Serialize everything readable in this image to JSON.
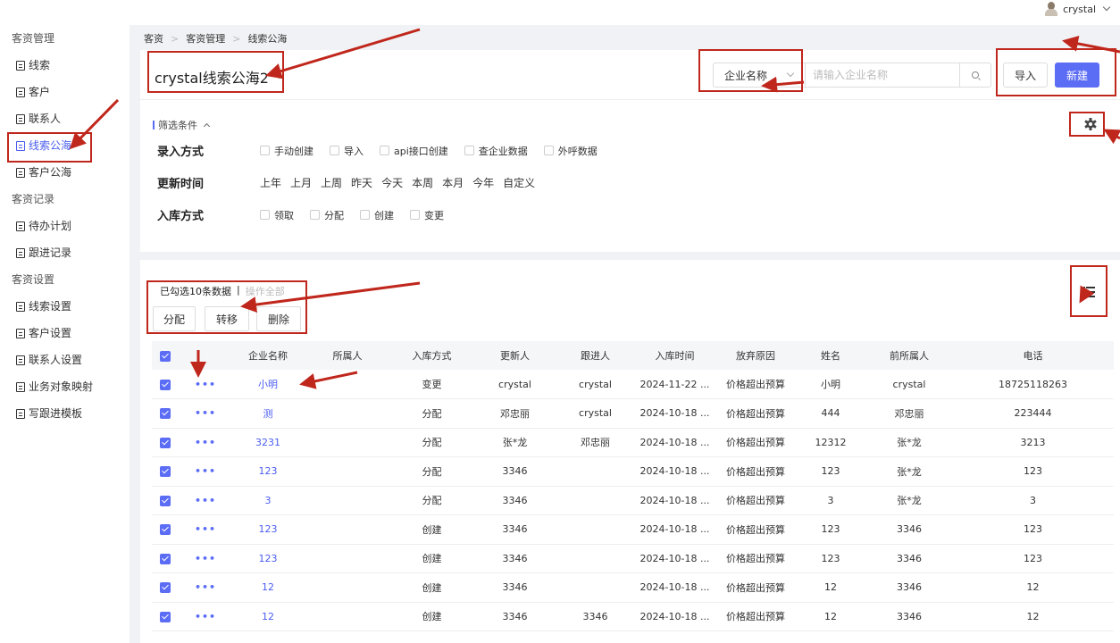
{
  "header": {
    "username": "crystal"
  },
  "sidebar": {
    "groups": [
      {
        "title": "客资管理",
        "items": [
          "线索",
          "客户",
          "联系人",
          "线索公海",
          "客户公海"
        ]
      },
      {
        "title": "客资记录",
        "items": [
          "待办计划",
          "跟进记录"
        ]
      },
      {
        "title": "客资设置",
        "items": [
          "线索设置",
          "客户设置",
          "联系人设置",
          "业务对象映射",
          "写跟进模板"
        ]
      }
    ],
    "active_item": "线索公海"
  },
  "breadcrumb": [
    "客资",
    "客资管理",
    "线索公海"
  ],
  "page": {
    "title": "crystal线索公海2"
  },
  "search": {
    "field_select": "企业名称",
    "placeholder": "请输入企业名称",
    "import_label": "导入",
    "new_label": "新建"
  },
  "filter": {
    "toggle_label": "筛选条件",
    "rows": [
      {
        "label": "录入方式",
        "type": "checkbox",
        "options": [
          "手动创建",
          "导入",
          "api接口创建",
          "查企业数据",
          "外呼数据"
        ]
      },
      {
        "label": "更新时间",
        "type": "text",
        "options": [
          "上年",
          "上月",
          "上周",
          "昨天",
          "今天",
          "本周",
          "本月",
          "今年",
          "自定义"
        ]
      },
      {
        "label": "入库方式",
        "type": "checkbox",
        "options": [
          "领取",
          "分配",
          "创建",
          "变更"
        ]
      }
    ]
  },
  "selection": {
    "info": "已勾选10条数据",
    "separator": "|",
    "all_label": "操作全部"
  },
  "actions": {
    "assign": "分配",
    "transfer": "转移",
    "delete": "删除"
  },
  "table": {
    "columns": [
      "企业名称",
      "所属人",
      "入库方式",
      "更新人",
      "跟进人",
      "入库时间",
      "放弃原因",
      "姓名",
      "前所属人",
      "电话"
    ],
    "rows": [
      [
        "小明",
        "",
        "变更",
        "crystal",
        "crystal",
        "2024-11-22 ...",
        "价格超出预算",
        "小明",
        "crystal",
        "18725118263"
      ],
      [
        "测",
        "",
        "分配",
        "邓忠丽",
        "crystal",
        "2024-10-18 ...",
        "价格超出预算",
        "444",
        "邓忠丽",
        "223444"
      ],
      [
        "3231",
        "",
        "分配",
        "张*龙",
        "邓忠丽",
        "2024-10-18 ...",
        "价格超出预算",
        "12312",
        "张*龙",
        "3213"
      ],
      [
        "123",
        "",
        "分配",
        "3346",
        "",
        "2024-10-18 ...",
        "价格超出预算",
        "123",
        "张*龙",
        "123"
      ],
      [
        "3",
        "",
        "分配",
        "3346",
        "",
        "2024-10-18 ...",
        "价格超出预算",
        "3",
        "张*龙",
        "3"
      ],
      [
        "123",
        "",
        "创建",
        "3346",
        "",
        "2024-10-18 ...",
        "价格超出预算",
        "123",
        "3346",
        "123"
      ],
      [
        "123",
        "",
        "创建",
        "3346",
        "",
        "2024-10-18 ...",
        "价格超出预算",
        "123",
        "3346",
        "123"
      ],
      [
        "12",
        "",
        "创建",
        "3346",
        "",
        "2024-10-18 ...",
        "价格超出预算",
        "12",
        "3346",
        "12"
      ],
      [
        "12",
        "",
        "创建",
        "3346",
        "3346",
        "2024-10-18 ...",
        "价格超出预算",
        "12",
        "3346",
        "12"
      ]
    ],
    "more_symbol": "•••"
  },
  "colors": {
    "accent": "#5b6cf5",
    "annotation": "#c0271c"
  }
}
